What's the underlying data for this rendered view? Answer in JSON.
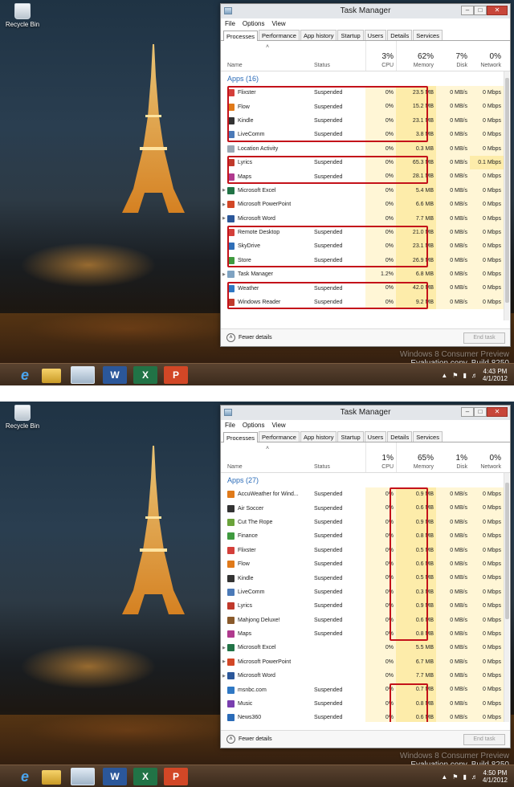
{
  "screenshots": [
    {
      "desktop": {
        "recycle_bin": "Recycle Bin",
        "watermark_line1": "Windows 8 Consumer Preview",
        "watermark_line2": "Evaluation copy. Build 8250",
        "clock_time": "4:43 PM",
        "clock_date": "4/1/2012"
      },
      "task_manager": {
        "title": "Task Manager",
        "menu": [
          "File",
          "Options",
          "View"
        ],
        "tabs": [
          "Processes",
          "Performance",
          "App history",
          "Startup",
          "Users",
          "Details",
          "Services"
        ],
        "columns": {
          "name": "Name",
          "status": "Status",
          "cpu_pct": "3%",
          "cpu": "CPU",
          "mem_pct": "62%",
          "mem": "Memory",
          "disk_pct": "7%",
          "disk": "Disk",
          "net_pct": "0%",
          "net": "Network"
        },
        "group_label": "Apps (16)",
        "rows": [
          {
            "name": "Flixster",
            "status": "Suspended",
            "cpu": "0%",
            "mem": "23.5 MB",
            "disk": "0 MB/s",
            "net": "0 Mbps",
            "icon_color": "#d43f3a"
          },
          {
            "name": "Flow",
            "status": "Suspended",
            "cpu": "0%",
            "mem": "15.2 MB",
            "disk": "0 MB/s",
            "net": "0 Mbps",
            "icon_color": "#e07a1a"
          },
          {
            "name": "Kindle",
            "status": "Suspended",
            "cpu": "0%",
            "mem": "23.1 MB",
            "disk": "0 MB/s",
            "net": "0 Mbps",
            "icon_color": "#333333"
          },
          {
            "name": "LiveComm",
            "status": "Suspended",
            "cpu": "0%",
            "mem": "3.8 MB",
            "disk": "0 MB/s",
            "net": "0 Mbps",
            "icon_color": "#4b7ab8"
          },
          {
            "name": "Location Activity",
            "status": "",
            "cpu": "0%",
            "mem": "0.3 MB",
            "disk": "0 MB/s",
            "net": "0 Mbps",
            "icon_color": "#9aa7b4"
          },
          {
            "name": "Lyrics",
            "status": "Suspended",
            "cpu": "0%",
            "mem": "65.3 MB",
            "disk": "0 MB/s",
            "net": "0.1 Mbps",
            "icon_color": "#c0392b"
          },
          {
            "name": "Maps",
            "status": "Suspended",
            "cpu": "0%",
            "mem": "28.1 MB",
            "disk": "0 MB/s",
            "net": "0 Mbps",
            "icon_color": "#b03a8e"
          },
          {
            "name": "Microsoft Excel",
            "status": "",
            "cpu": "0%",
            "mem": "5.4 MB",
            "disk": "0 MB/s",
            "net": "0 Mbps",
            "icon_color": "#217346",
            "expand": true
          },
          {
            "name": "Microsoft PowerPoint",
            "status": "",
            "cpu": "0%",
            "mem": "6.6 MB",
            "disk": "0 MB/s",
            "net": "0 Mbps",
            "icon_color": "#d24726",
            "expand": true
          },
          {
            "name": "Microsoft Word",
            "status": "",
            "cpu": "0%",
            "mem": "7.7 MB",
            "disk": "0 MB/s",
            "net": "0 Mbps",
            "icon_color": "#2b579a",
            "expand": true
          },
          {
            "name": "Remote Desktop",
            "status": "Suspended",
            "cpu": "0%",
            "mem": "21.0 MB",
            "disk": "0 MB/s",
            "net": "0 Mbps",
            "icon_color": "#d43f3a"
          },
          {
            "name": "SkyDrive",
            "status": "Suspended",
            "cpu": "0%",
            "mem": "23.1 MB",
            "disk": "0 MB/s",
            "net": "0 Mbps",
            "icon_color": "#2f6fb8"
          },
          {
            "name": "Store",
            "status": "Suspended",
            "cpu": "0%",
            "mem": "26.9 MB",
            "disk": "0 MB/s",
            "net": "0 Mbps",
            "icon_color": "#3f9a3f"
          },
          {
            "name": "Task Manager",
            "status": "",
            "cpu": "1.2%",
            "mem": "6.8 MB",
            "disk": "0 MB/s",
            "net": "0 Mbps",
            "icon_color": "#7fa3c2",
            "expand": true
          },
          {
            "name": "Weather",
            "status": "Suspended",
            "cpu": "0%",
            "mem": "42.0 MB",
            "disk": "0 MB/s",
            "net": "0 Mbps",
            "icon_color": "#2f78c4"
          },
          {
            "name": "Windows Reader",
            "status": "Suspended",
            "cpu": "0%",
            "mem": "9.2 MB",
            "disk": "0 MB/s",
            "net": "0 Mbps",
            "icon_color": "#c0392b"
          }
        ],
        "fewer_details": "Fewer details",
        "end_task": "End task"
      }
    },
    {
      "desktop": {
        "recycle_bin": "Recycle Bin",
        "watermark_line1": "Windows 8 Consumer Preview",
        "watermark_line2": "Evaluation copy. Build 8250",
        "clock_time": "4:50 PM",
        "clock_date": "4/1/2012"
      },
      "task_manager": {
        "title": "Task Manager",
        "menu": [
          "File",
          "Options",
          "View"
        ],
        "tabs": [
          "Processes",
          "Performance",
          "App history",
          "Startup",
          "Users",
          "Details",
          "Services"
        ],
        "columns": {
          "name": "Name",
          "status": "Status",
          "cpu_pct": "1%",
          "cpu": "CPU",
          "mem_pct": "65%",
          "mem": "Memory",
          "disk_pct": "1%",
          "disk": "Disk",
          "net_pct": "0%",
          "net": "Network"
        },
        "group_label": "Apps (27)",
        "rows": [
          {
            "name": "AccuWeather for Wind...",
            "status": "Suspended",
            "cpu": "0%",
            "mem": "0.9 MB",
            "disk": "0 MB/s",
            "net": "0 Mbps",
            "icon_color": "#e07a1a"
          },
          {
            "name": "Air Soccer",
            "status": "Suspended",
            "cpu": "0%",
            "mem": "0.6 MB",
            "disk": "0 MB/s",
            "net": "0 Mbps",
            "icon_color": "#333333"
          },
          {
            "name": "Cut The Rope",
            "status": "Suspended",
            "cpu": "0%",
            "mem": "0.9 MB",
            "disk": "0 MB/s",
            "net": "0 Mbps",
            "icon_color": "#6aa33a"
          },
          {
            "name": "Finance",
            "status": "Suspended",
            "cpu": "0%",
            "mem": "0.8 MB",
            "disk": "0 MB/s",
            "net": "0 Mbps",
            "icon_color": "#3f9a3f"
          },
          {
            "name": "Flixster",
            "status": "Suspended",
            "cpu": "0%",
            "mem": "0.5 MB",
            "disk": "0 MB/s",
            "net": "0 Mbps",
            "icon_color": "#d43f3a"
          },
          {
            "name": "Flow",
            "status": "Suspended",
            "cpu": "0%",
            "mem": "0.6 MB",
            "disk": "0 MB/s",
            "net": "0 Mbps",
            "icon_color": "#e07a1a"
          },
          {
            "name": "Kindle",
            "status": "Suspended",
            "cpu": "0%",
            "mem": "0.5 MB",
            "disk": "0 MB/s",
            "net": "0 Mbps",
            "icon_color": "#333333"
          },
          {
            "name": "LiveComm",
            "status": "Suspended",
            "cpu": "0%",
            "mem": "0.3 MB",
            "disk": "0 MB/s",
            "net": "0 Mbps",
            "icon_color": "#4b7ab8"
          },
          {
            "name": "Lyrics",
            "status": "Suspended",
            "cpu": "0%",
            "mem": "0.9 MB",
            "disk": "0 MB/s",
            "net": "0 Mbps",
            "icon_color": "#c0392b"
          },
          {
            "name": "Mahjong Deluxe!",
            "status": "Suspended",
            "cpu": "0%",
            "mem": "0.6 MB",
            "disk": "0 MB/s",
            "net": "0 Mbps",
            "icon_color": "#8a5a2b"
          },
          {
            "name": "Maps",
            "status": "Suspended",
            "cpu": "0%",
            "mem": "0.8 MB",
            "disk": "0 MB/s",
            "net": "0 Mbps",
            "icon_color": "#b03a8e"
          },
          {
            "name": "Microsoft Excel",
            "status": "",
            "cpu": "0%",
            "mem": "5.5 MB",
            "disk": "0 MB/s",
            "net": "0 Mbps",
            "icon_color": "#217346",
            "expand": true
          },
          {
            "name": "Microsoft PowerPoint",
            "status": "",
            "cpu": "0%",
            "mem": "6.7 MB",
            "disk": "0 MB/s",
            "net": "0 Mbps",
            "icon_color": "#d24726",
            "expand": true
          },
          {
            "name": "Microsoft Word",
            "status": "",
            "cpu": "0%",
            "mem": "7.7 MB",
            "disk": "0 MB/s",
            "net": "0 Mbps",
            "icon_color": "#2b579a",
            "expand": true
          },
          {
            "name": "msnbc.com",
            "status": "Suspended",
            "cpu": "0%",
            "mem": "0.7 MB",
            "disk": "0 MB/s",
            "net": "0 Mbps",
            "icon_color": "#2f78c4"
          },
          {
            "name": "Music",
            "status": "Suspended",
            "cpu": "0%",
            "mem": "0.8 MB",
            "disk": "0 MB/s",
            "net": "0 Mbps",
            "icon_color": "#7a3fb0"
          },
          {
            "name": "News360",
            "status": "Suspended",
            "cpu": "0%",
            "mem": "0.6 MB",
            "disk": "0 MB/s",
            "net": "0 Mbps",
            "icon_color": "#2a6bb8"
          }
        ],
        "fewer_details": "Fewer details",
        "end_task": "End task"
      }
    }
  ]
}
